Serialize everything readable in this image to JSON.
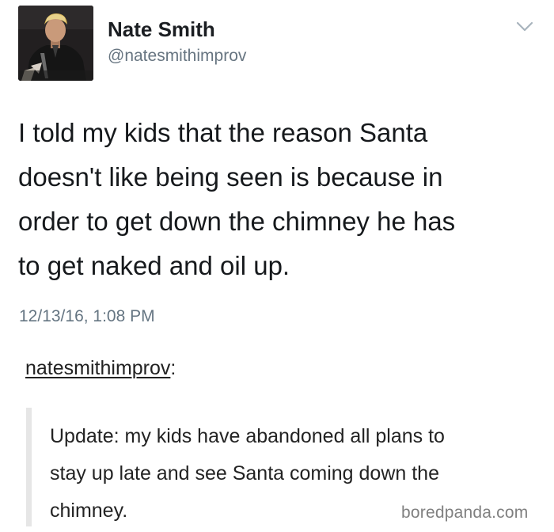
{
  "tweet": {
    "author_name": "Nate Smith",
    "author_handle": "@natesmithimprov",
    "text": "I told my kids that the reason Santa\ndoesn't like being seen is because in\norder to get down the chimney he has\nto get naked and oil up.",
    "timestamp": "12/13/16, 1:08 PM",
    "menu_icon": "chevron-down-icon"
  },
  "reblog": {
    "username": "natesmithimprov",
    "separator": ":",
    "text": "Update: my kids have abandoned all plans to\nstay up late and see Santa coming down the\nchimney."
  },
  "watermark": {
    "text": "boredpanda.com"
  },
  "colors": {
    "name": "#1b1e22",
    "handle": "#677581",
    "timestamp": "#657582",
    "quote_bar": "#e6e6e6",
    "watermark": "#808080"
  }
}
